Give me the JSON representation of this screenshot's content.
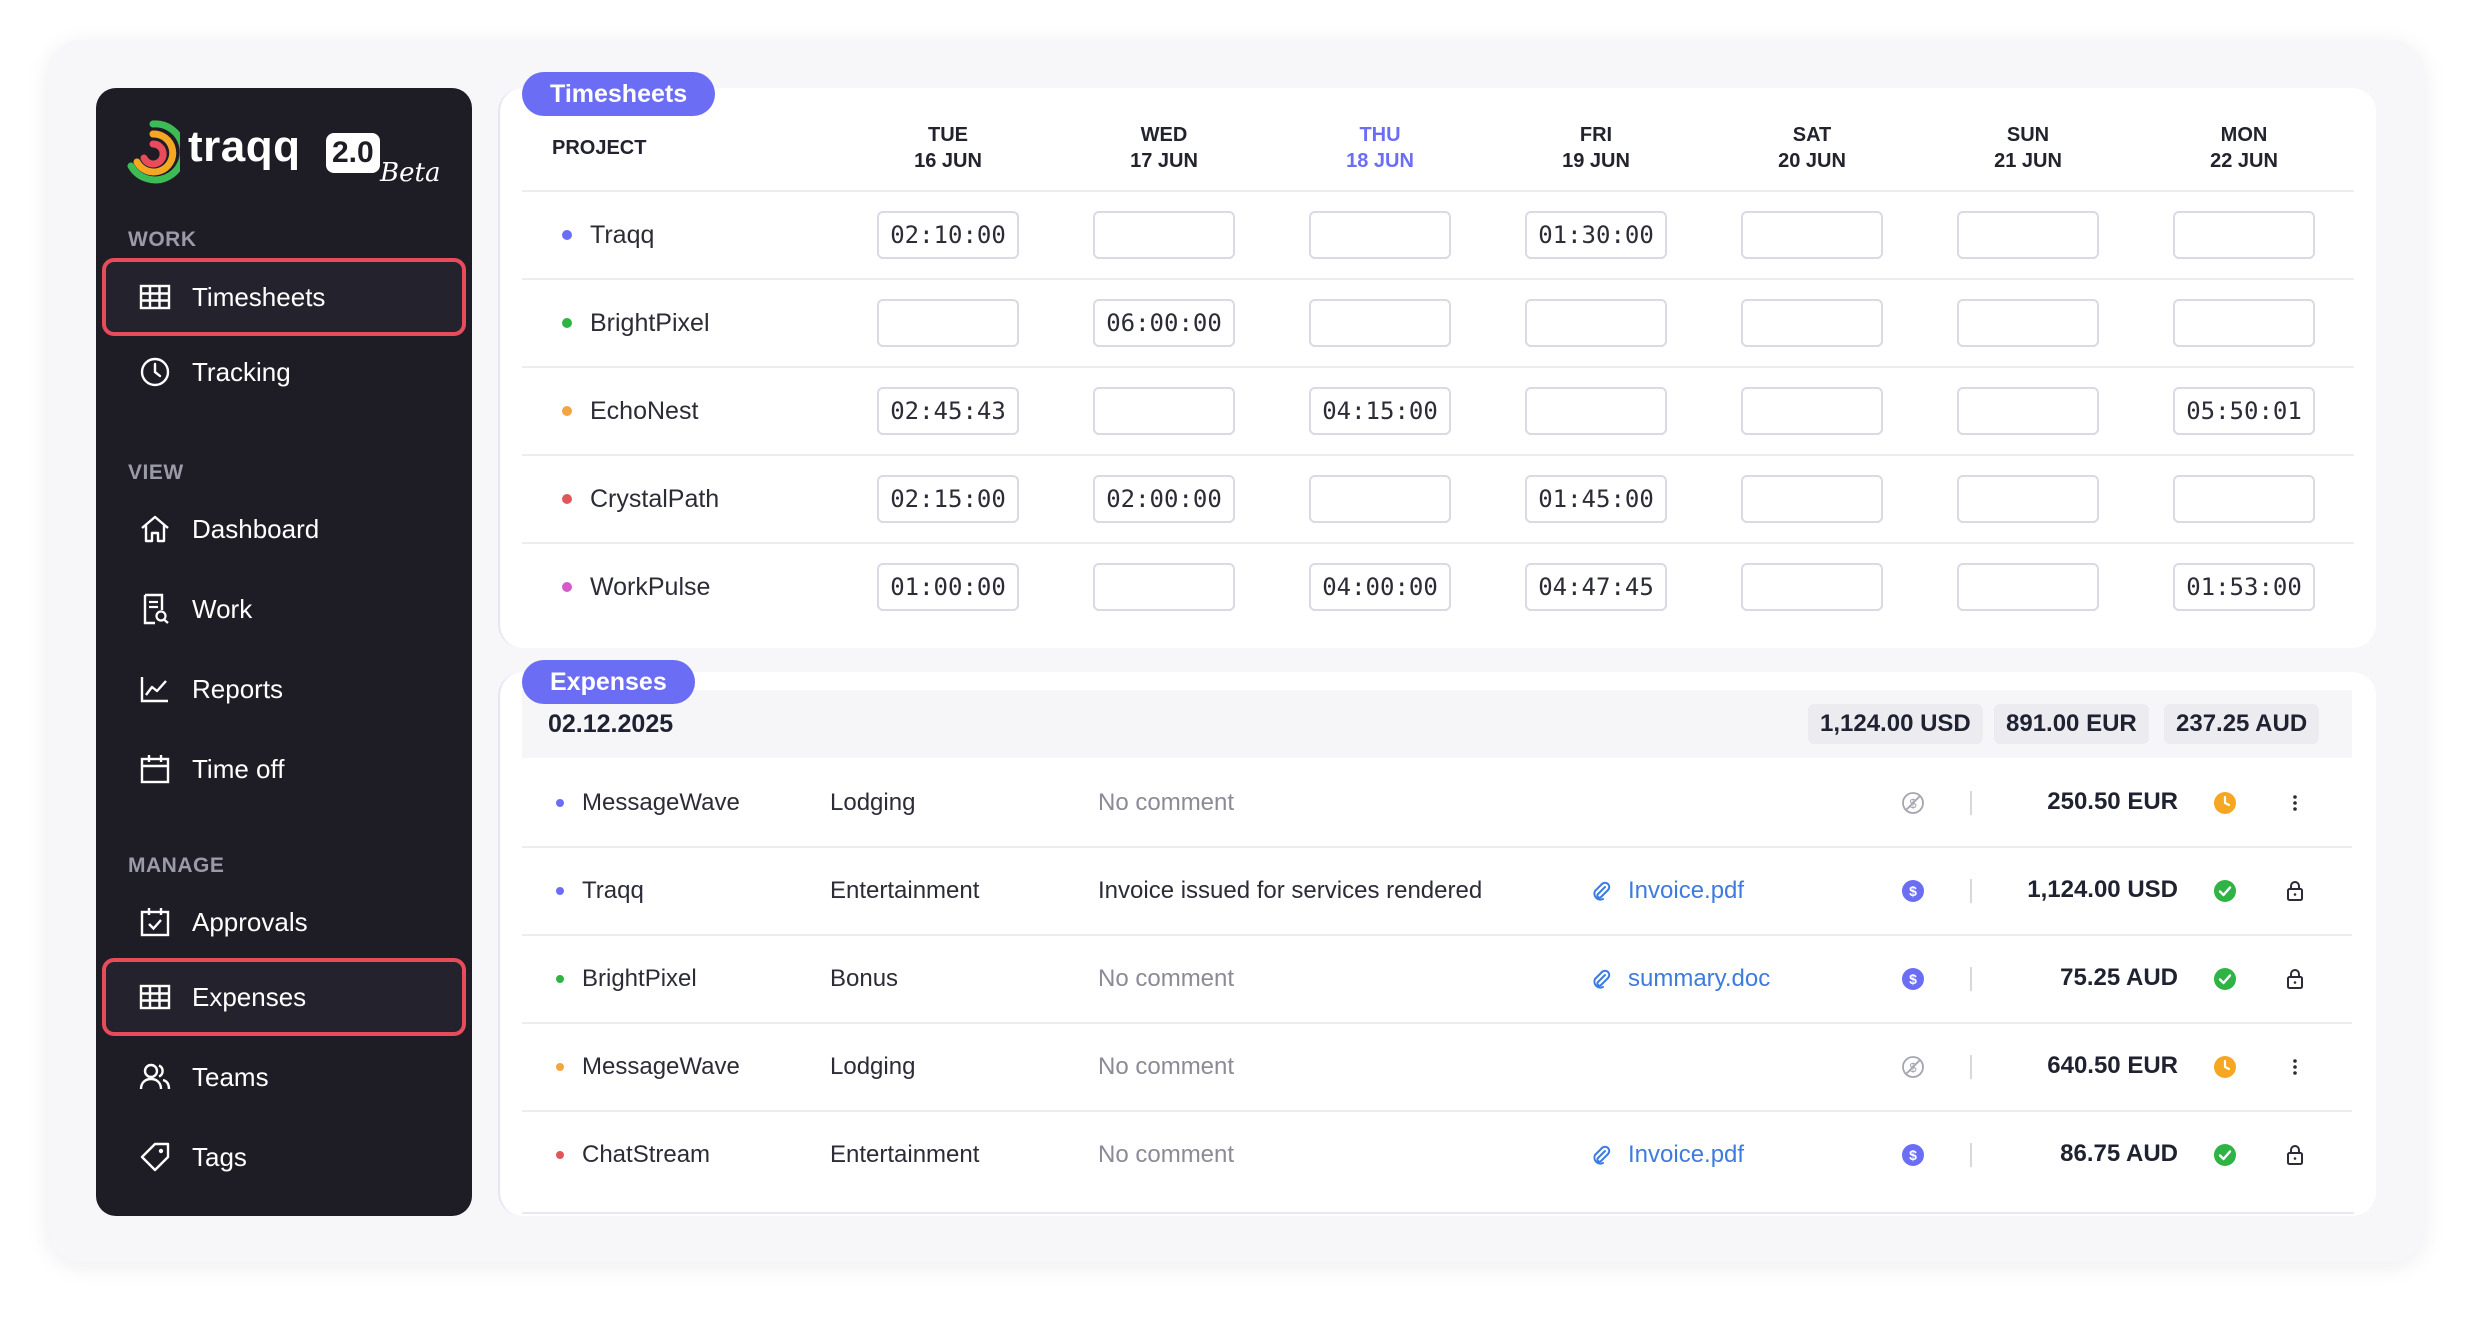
{
  "sidebar": {
    "logo": {
      "word": "traqq",
      "version": "2.0",
      "tag": "Beta"
    },
    "sections": {
      "work": "WORK",
      "view": "VIEW",
      "manage": "MANAGE"
    },
    "items": {
      "timesheets": "Timesheets",
      "tracking": "Tracking",
      "dashboard": "Dashboard",
      "work": "Work",
      "reports": "Reports",
      "timeoff": "Time off",
      "approvals": "Approvals",
      "expenses": "Expenses",
      "teams": "Teams",
      "tags": "Tags"
    }
  },
  "timesheets": {
    "title": "Timesheets",
    "project_header": "PROJECT",
    "days": [
      {
        "dow": "TUE",
        "date": "16 JUN"
      },
      {
        "dow": "WED",
        "date": "17 JUN"
      },
      {
        "dow": "THU",
        "date": "18 JUN"
      },
      {
        "dow": "FRI",
        "date": "19 JUN"
      },
      {
        "dow": "SAT",
        "date": "20 JUN"
      },
      {
        "dow": "SUN",
        "date": "21 JUN"
      },
      {
        "dow": "MON",
        "date": "22 JUN"
      }
    ],
    "rows": [
      {
        "project": "Traqq",
        "color": "#6b6ef5",
        "times": [
          "02:10:00",
          "",
          "",
          "01:30:00",
          "",
          "",
          ""
        ]
      },
      {
        "project": "BrightPixel",
        "color": "#2fb344",
        "times": [
          "",
          "06:00:00",
          "",
          "",
          "",
          "",
          ""
        ]
      },
      {
        "project": "EchoNest",
        "color": "#f5a442",
        "times": [
          "02:45:43",
          "",
          "04:15:00",
          "",
          "",
          "",
          "05:50:01"
        ]
      },
      {
        "project": "CrystalPath",
        "color": "#e0575b",
        "times": [
          "02:15:00",
          "02:00:00",
          "",
          "01:45:00",
          "",
          "",
          ""
        ]
      },
      {
        "project": "WorkPulse",
        "color": "#d45bc8",
        "times": [
          "01:00:00",
          "",
          "04:00:00",
          "04:47:45",
          "",
          "",
          "01:53:00"
        ]
      }
    ]
  },
  "expenses": {
    "title": "Expenses",
    "date": "02.12.2025",
    "totals": [
      "1,124.00 USD",
      "891.00 EUR",
      "237.25 AUD"
    ],
    "rows": [
      {
        "project": "MessageWave",
        "color": "#6b6ef5",
        "category": "Lodging",
        "comment": "No comment",
        "file": "",
        "amount": "250.50 EUR",
        "billable": false,
        "status": "pending",
        "action": "more-icon"
      },
      {
        "project": "Traqq",
        "color": "#6b6ef5",
        "category": "Entertainment",
        "comment": "Invoice issued for services rendered",
        "file": "Invoice.pdf",
        "amount": "1,124.00 USD",
        "billable": true,
        "status": "approved",
        "action": "lock-icon"
      },
      {
        "project": "BrightPixel",
        "color": "#2fb344",
        "category": "Bonus",
        "comment": "No comment",
        "file": "summary.doc",
        "amount": "75.25 AUD",
        "billable": true,
        "status": "approved",
        "action": "lock-icon"
      },
      {
        "project": "MessageWave",
        "color": "#f5a442",
        "category": "Lodging",
        "comment": "No comment",
        "file": "",
        "amount": "640.50 EUR",
        "billable": false,
        "status": "pending",
        "action": "more-icon"
      },
      {
        "project": "ChatStream",
        "color": "#e0575b",
        "category": "Entertainment",
        "comment": "No comment",
        "file": "Invoice.pdf",
        "amount": "86.75 AUD",
        "billable": true,
        "status": "approved",
        "action": "lock-icon"
      }
    ]
  },
  "colors": {
    "accent": "#6b6ef5",
    "sidebar_bg": "#1e1d26",
    "selected_border": "#e84c5a",
    "approved": "#2fb344",
    "pending": "#f5a623",
    "link": "#3d7be0"
  }
}
